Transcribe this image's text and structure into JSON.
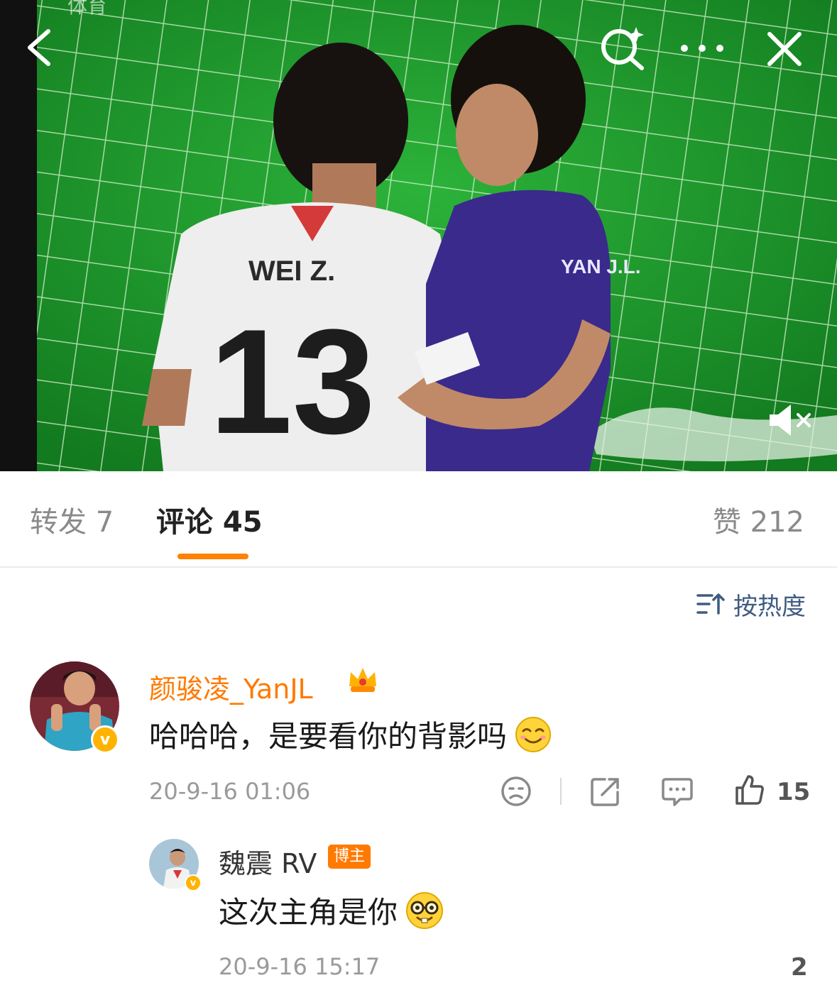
{
  "video": {
    "watermark": "体育",
    "jersey_white_name": "WEI Z.",
    "jersey_white_number": "13",
    "jersey_purple_name": "YAN J.L."
  },
  "tabs": {
    "repost": "转发 7",
    "comments": "评论 45",
    "likes": "赞 212"
  },
  "sort": {
    "label": "按热度"
  },
  "comment": {
    "username": "颜骏凌_YanJL",
    "text": "哈哈哈，是要看你的背影吗",
    "time": "20-9-16 01:06",
    "like_count": "15",
    "verified_badge": "v"
  },
  "reply": {
    "username": "魏震 RV",
    "badge": "博主",
    "text": "这次主角是你",
    "time": "20-9-16 15:17",
    "like_count": "2"
  },
  "colors": {
    "accent": "#ff8200",
    "username": "#ff7a00",
    "sort_blue": "#3f5c80",
    "pitch_green": "#1e9a2c"
  }
}
